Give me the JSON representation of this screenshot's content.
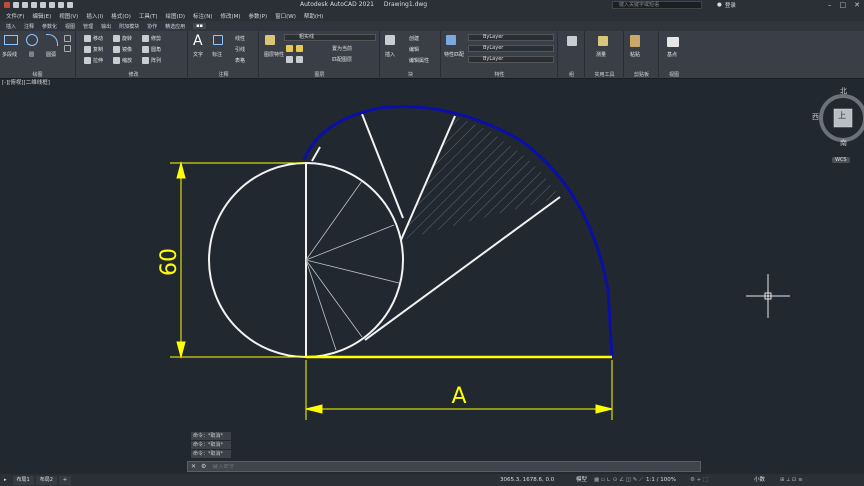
{
  "titlebar": {
    "app_title": "Autodesk AutoCAD 2021",
    "file_name": "Drawing1.dwg",
    "search_placeholder": "键入关键字或短语",
    "login_label": "登录"
  },
  "menubar": {
    "items": [
      "文件(F)",
      "编辑(E)",
      "视图(V)",
      "插入(I)",
      "格式(O)",
      "工具(T)",
      "绘图(D)",
      "标注(N)",
      "修改(M)",
      "参数(P)",
      "窗口(W)",
      "帮助(H)"
    ]
  },
  "ribbon_tabs": [
    "插入",
    "注释",
    "参数化",
    "视图",
    "管理",
    "输出",
    "附加模块",
    "协作",
    "精选应用"
  ],
  "ribbon": {
    "draw": {
      "label": "绘图",
      "line": "多段线",
      "circle": "圆",
      "arc": "圆弧"
    },
    "modify": {
      "label": "修改",
      "move": "移动",
      "rotate": "旋转",
      "trim": "修剪",
      "copy": "复制",
      "mirror": "镜像",
      "fillet": "圆角",
      "stretch": "拉伸",
      "scale": "缩放",
      "array": "阵列"
    },
    "annotation": {
      "label": "注释",
      "text": "文字",
      "dimension": "标注",
      "linear": "线性",
      "leader": "引线",
      "table": "表格"
    },
    "layers": {
      "label": "图层",
      "layer_props": "图层特性",
      "layer_name": "粗实线",
      "make_current": "置为当前",
      "match": "匹配图层"
    },
    "block": {
      "label": "块",
      "insert": "插入",
      "create": "创建",
      "edit": "编辑",
      "edit_attr": "编辑属性"
    },
    "properties": {
      "label": "特性",
      "match_props": "特性匹配",
      "bylayer1": "ByLayer",
      "bylayer2": "ByLayer",
      "bylayer3": "ByLayer"
    },
    "groups": {
      "label": "组"
    },
    "utilities": {
      "label": "实用工具",
      "measure": "测量"
    },
    "clipboard": {
      "label": "剪贴板",
      "paste": "粘贴"
    },
    "view": {
      "label": "视图",
      "base": "基点"
    }
  },
  "doc_tab": "[-][俯视][二维线框]",
  "viewcube": {
    "north": "北",
    "south": "南",
    "west": "西",
    "top": "上",
    "wcs": "WCS"
  },
  "drawing": {
    "dim_vertical": "60",
    "dim_horizontal": "A",
    "colors": {
      "white": "#f2f2f2",
      "yellow": "#ffff00",
      "blue": "#0a0fa8",
      "hatch": "#9aa0a6"
    }
  },
  "command": {
    "history": [
      "命令：*取消*",
      "命令：*取消*",
      "命令：*取消*"
    ],
    "placeholder": "键入命令"
  },
  "statusbar": {
    "layouts": [
      "布局1",
      "布局2"
    ],
    "coords": "3065.3, 1678.6, 0.0",
    "model": "模型",
    "scale": "1:1 / 100%",
    "units": "小数"
  }
}
